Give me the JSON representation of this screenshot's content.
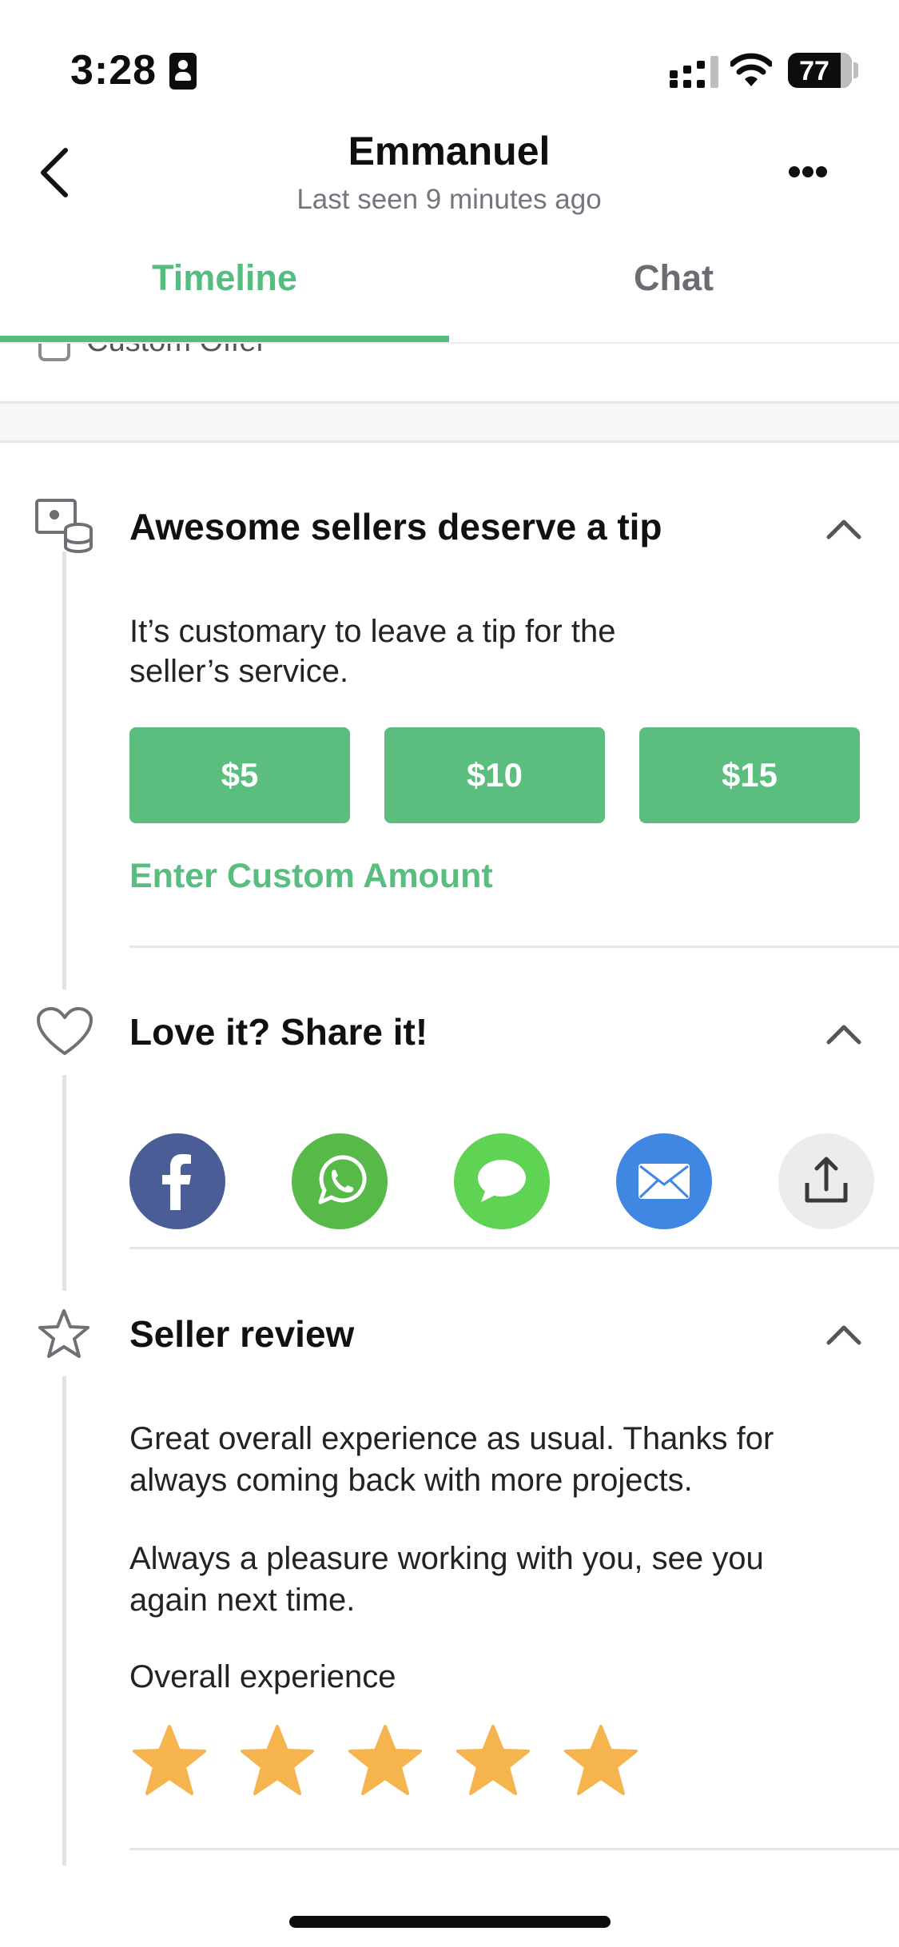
{
  "status_bar": {
    "time": "3:28",
    "battery": "77"
  },
  "header": {
    "title": "Emmanuel",
    "subtitle": "Last seen 9 minutes ago"
  },
  "tabs": [
    {
      "label": "Timeline",
      "active": true
    },
    {
      "label": "Chat",
      "active": false
    }
  ],
  "clipped_item": {
    "label": "Custom Offer",
    "icon": "offer-icon"
  },
  "tip_section": {
    "title": "Awesome sellers deserve a tip",
    "description_line1": "It’s customary to leave a tip for the",
    "description_line2": "seller’s service.",
    "amounts": [
      "$5",
      "$10",
      "$15"
    ],
    "custom_label": "Enter Custom Amount",
    "icon": "tip-icon"
  },
  "share_section": {
    "title": "Love it? Share it!",
    "icon": "heart-icon",
    "targets": [
      "facebook",
      "whatsapp",
      "messages",
      "email",
      "share-sheet"
    ]
  },
  "review_section": {
    "title": "Seller review",
    "icon": "star-outline-icon",
    "paragraph1_line1": "Great overall experience as usual. Thanks for",
    "paragraph1_line2": "always coming back with more projects.",
    "paragraph2_line1": "Always a pleasure working with you, see you",
    "paragraph2_line2": "again next time.",
    "rating_label": "Overall experience",
    "rating": 5,
    "rating_max": 5
  },
  "colors": {
    "accent": "#55bd7f",
    "star": "#f5b44d",
    "facebook": "#4a5d96",
    "whatsapp": "#56b948",
    "messages": "#5fd353",
    "email": "#3f87e3"
  }
}
